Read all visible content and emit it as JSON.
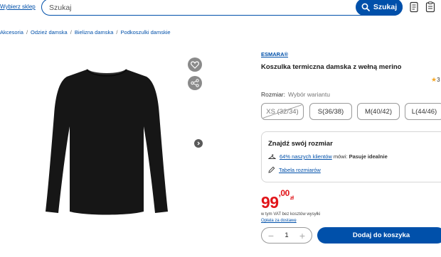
{
  "header": {
    "store_link": "Wybierz sklep",
    "search_placeholder": "Szukaj",
    "search_button": "Szukaj"
  },
  "breadcrumb": [
    "Akcesoria",
    "Odzież damska",
    "Bielizna damska",
    "Podkoszulki damskie"
  ],
  "product": {
    "brand": "ESMARA®",
    "title": "Koszulka termiczna damska z wełną merino",
    "rating_partial": "3",
    "size_label": "Rozmiar:",
    "size_hint": "Wybór wariantu",
    "sizes": [
      "XS (32/34)",
      "S(36/38)",
      "M(40/42)",
      "L(44/46)"
    ],
    "unavailable_size_index": 0
  },
  "fit": {
    "title": "Znajdź swój rozmiar",
    "customers_link": "64% naszych klientów",
    "customers_says": "mówi:",
    "verdict": "Pasuje idealnie",
    "size_table_link": "Tabela rozmiarów"
  },
  "pricing": {
    "price_main": "99",
    "price_cents": ",00",
    "currency": "zł",
    "vat_note": "w tym VAT bez kosztów wysyłki",
    "shipping_link": "Opłata za dostawę",
    "accent_color": "#e1151a"
  },
  "cart": {
    "quantity": "1",
    "add_button": "Dodaj do koszyka",
    "brand_color": "#0050aa"
  },
  "icons": {
    "search": "search-icon",
    "wishlist": "heart-icon",
    "share": "share-icon",
    "next": "chevron-right-icon",
    "hanger": "hanger-icon",
    "ruler": "pencil-ruler-icon"
  }
}
